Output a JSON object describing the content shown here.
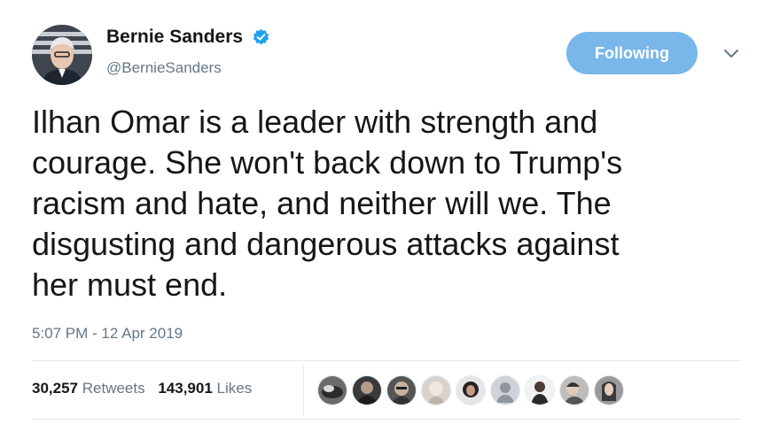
{
  "author": {
    "display_name": "Bernie Sanders",
    "handle": "@BernieSanders",
    "verified_icon": "verified-badge-icon",
    "avatar_icon": "profile-photo"
  },
  "follow_button": {
    "label": "Following"
  },
  "menu_icon": "chevron-down-icon",
  "tweet": {
    "text": "Ilhan Omar is a leader with strength and\ncourage. She won't back down to Trump's\nracism and hate, and neither will we. The\ndisgusting and dangerous attacks against\nher must end.",
    "timestamp": "5:07 PM - 12 Apr 2019"
  },
  "stats": {
    "retweets_count": "30,257",
    "retweets_label": "Retweets",
    "likes_count": "143,901",
    "likes_label": "Likes"
  },
  "colors": {
    "follow_button_bg": "#79b6e9",
    "verified_blue": "#1da1f2",
    "secondary_text": "#657786",
    "divider": "#e1e8ed"
  }
}
